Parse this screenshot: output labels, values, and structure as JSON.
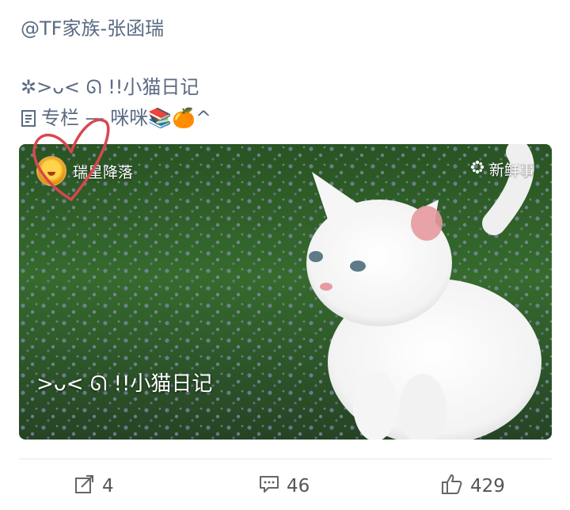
{
  "post": {
    "mention": "@TF家族-张函瑞",
    "title": "✲>ᴗ< ᘏ !!小猫日记",
    "subtitle": "专栏 — 咪咪📚🍊^"
  },
  "card": {
    "author_name": "瑞星降落",
    "source_label": "新鲜事",
    "caption": ">ᴗ< ᘏ !!小猫日记"
  },
  "actions": {
    "repost_count": "4",
    "comment_count": "46",
    "like_count": "429"
  },
  "colors": {
    "accent_text": "#5b6b83",
    "heart_stroke": "#d9464f"
  },
  "icons": {
    "column": "column-icon",
    "source": "star-icon",
    "repost": "repost-icon",
    "comment": "comment-icon",
    "like": "thumbs-up-icon"
  }
}
